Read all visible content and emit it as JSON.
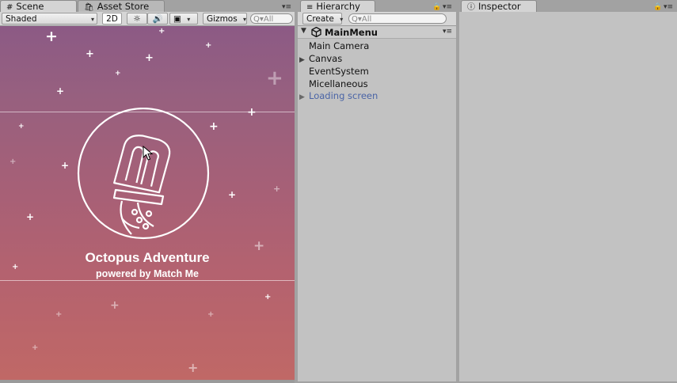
{
  "scene_panel": {
    "tab_label": "Scene",
    "tab_icon": "grid-icon",
    "shading_label": "Shaded",
    "mode_2d_label": "2D",
    "gizmos_label": "Gizmos",
    "search_placeholder": "All",
    "game": {
      "title": "Octopus Adventure",
      "subtitle": "powered by Match Me"
    }
  },
  "asset_store_tab": {
    "label": "Asset Store"
  },
  "hierarchy": {
    "tab_label": "Hierarchy",
    "create_label": "Create",
    "search_placeholder": "All",
    "scene_name": "MainMenu",
    "items": [
      {
        "label": "Main Camera",
        "expandable": false,
        "color": "#111111"
      },
      {
        "label": "Canvas",
        "expandable": true,
        "color": "#111111"
      },
      {
        "label": "EventSystem",
        "expandable": false,
        "color": "#111111"
      },
      {
        "label": "Micellaneous",
        "expandable": false,
        "color": "#111111"
      },
      {
        "label": "Loading screen",
        "expandable": true,
        "color": "#4a64a6"
      }
    ]
  },
  "inspector": {
    "tab_label": "Inspector"
  },
  "colors": {
    "panel_bg": "#c2c2c2",
    "toolbar_bg": "#d6d6d6",
    "inactive_item": "#4a64a6"
  }
}
